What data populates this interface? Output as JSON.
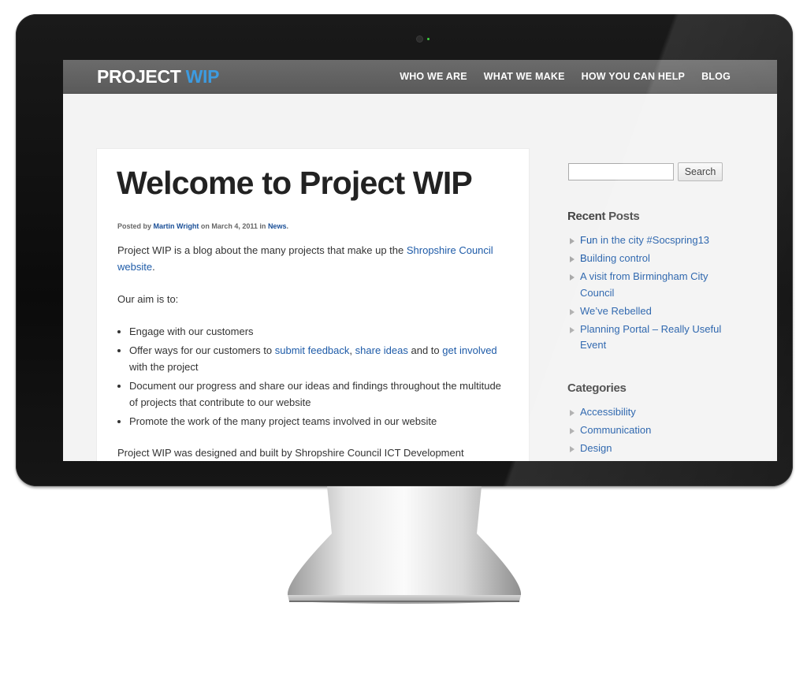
{
  "site": {
    "logo_main": "PROJECT",
    "logo_accent": "WIP",
    "nav": [
      {
        "label": "WHO WE ARE"
      },
      {
        "label": "WHAT WE MAKE"
      },
      {
        "label": "HOW YOU CAN HELP"
      },
      {
        "label": "BLOG"
      }
    ]
  },
  "post": {
    "title": "Welcome to Project WIP",
    "byline": {
      "posted_by": "Posted by",
      "author": "Martin Wright",
      "date_text": "on March 4, 2011 in",
      "category": "News",
      "end": "."
    },
    "intro": {
      "text": "Project WIP is a blog about the many projects that make up the",
      "link": "Shropshire Council website",
      "end": "."
    },
    "aim": "Our aim is to:",
    "bullets": {
      "b1": "Engage with our customers",
      "b2_pre": "Offer ways for our customers to",
      "b2_link1": "submit feedback",
      "b2_comma": ",",
      "b2_link2": "share ideas",
      "b2_mid": "and to",
      "b2_link3": "get involved",
      "b2_post": "with the project",
      "b3": "Document our progress and share our ideas and findings throughout the multitude of projects that contribute to our website",
      "b4": "Promote the work of the many project teams involved in our website"
    },
    "footer_text": "Project WIP was designed and built by Shropshire Council ICT Development"
  },
  "sidebar": {
    "search": {
      "placeholder": "",
      "button": "Search"
    },
    "recent_title": "Recent Posts",
    "recent": [
      {
        "label": "Fun in the city #Socspring13"
      },
      {
        "label": "Building control"
      },
      {
        "label": "A visit from Birmingham City Council"
      },
      {
        "label": "We’ve Rebelled"
      },
      {
        "label": "Planning Portal – Really Useful Event"
      }
    ],
    "categories_title": "Categories",
    "categories": [
      {
        "label": "Accessibility"
      },
      {
        "label": "Communication"
      },
      {
        "label": "Design"
      }
    ]
  },
  "colors": {
    "accent": "#3d9be0",
    "link": "#1e5ba8",
    "header_bg": "#5f5f5f"
  },
  "icons": {
    "bullet": "triangle-bullet-icon",
    "camera": "camera-icon"
  }
}
